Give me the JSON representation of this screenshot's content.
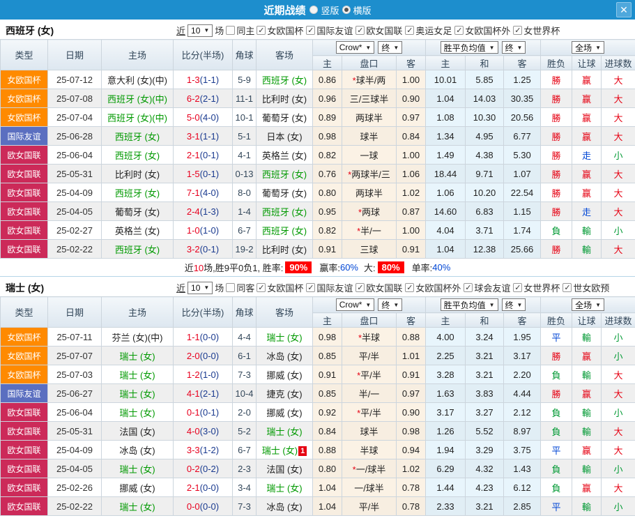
{
  "titlebar": {
    "title": "近期战绩",
    "radio_vertical": "竖版",
    "radio_horizontal": "横版",
    "close_glyph": "✕"
  },
  "icons": {
    "check": "✓",
    "arrow_down": "▼"
  },
  "colors": {
    "titlebar_blue": "#1d8ecd",
    "highlight_red": "#ff0000",
    "type_badge": {
      "女欧国杯": "#ff8a00",
      "国际友谊": "#5b6fc0",
      "欧女国联": "#cc2a59"
    },
    "result": {
      "r": "#e60012",
      "g": "#009933",
      "b": "#0046d5"
    }
  },
  "table_header": {
    "columns": [
      "类型",
      "日期",
      "主场",
      "比分(半场)",
      "角球",
      "客场"
    ],
    "sub": [
      "主",
      "盘口",
      "客",
      "主",
      "和",
      "客",
      "胜负",
      "让球",
      "进球数"
    ],
    "odds_source": "Crow*",
    "period1": "终",
    "avg_label": "胜平负均值",
    "period2": "终",
    "scope": "全场"
  },
  "sections": [
    {
      "team_title": "西班牙 (女)",
      "filter": {
        "near_label": "近",
        "count": "10",
        "games_label": "场",
        "same_label": "同主",
        "same_checked": false,
        "competitions": [
          "女欧国杯",
          "国际友谊",
          "欧女国联",
          "奥运女足",
          "女欧国杯外",
          "女世界杯"
        ]
      },
      "rows": [
        {
          "type": "女欧国杯",
          "date": "25-07-12",
          "home": "意大利 (女)(中)",
          "home_green": false,
          "ft": "1-3",
          "ht": "(1-1)",
          "corner": "5-9",
          "away": "西班牙 (女)",
          "away_green": true,
          "odds": [
            "0.86",
            "1.00"
          ],
          "handicap": "球半/两",
          "star": true,
          "avg": [
            "10.01",
            "5.85",
            "1.25"
          ],
          "results": [
            {
              "t": "勝",
              "c": "r"
            },
            {
              "t": "赢",
              "c": "r"
            },
            {
              "t": "大",
              "c": "r"
            }
          ]
        },
        {
          "type": "女欧国杯",
          "date": "25-07-08",
          "home": "西班牙 (女)(中)",
          "home_green": true,
          "ft": "6-2",
          "ht": "(2-1)",
          "corner": "11-1",
          "away": "比利时 (女)",
          "away_green": false,
          "odds": [
            "0.96",
            "0.90"
          ],
          "handicap": "三/三球半",
          "star": false,
          "avg": [
            "1.04",
            "14.03",
            "30.35"
          ],
          "results": [
            {
              "t": "勝",
              "c": "r"
            },
            {
              "t": "赢",
              "c": "r"
            },
            {
              "t": "大",
              "c": "r"
            }
          ]
        },
        {
          "type": "女欧国杯",
          "date": "25-07-04",
          "home": "西班牙 (女)(中)",
          "home_green": true,
          "ft": "5-0",
          "ht": "(4-0)",
          "corner": "10-1",
          "away": "葡萄牙 (女)",
          "away_green": false,
          "odds": [
            "0.89",
            "0.97"
          ],
          "handicap": "两球半",
          "star": false,
          "avg": [
            "1.08",
            "10.30",
            "20.56"
          ],
          "results": [
            {
              "t": "勝",
              "c": "r"
            },
            {
              "t": "赢",
              "c": "r"
            },
            {
              "t": "大",
              "c": "r"
            }
          ]
        },
        {
          "type": "国际友谊",
          "date": "25-06-28",
          "home": "西班牙 (女)",
          "home_green": true,
          "ft": "3-1",
          "ht": "(1-1)",
          "corner": "5-1",
          "away": "日本 (女)",
          "away_green": false,
          "odds": [
            "0.98",
            "0.84"
          ],
          "handicap": "球半",
          "star": false,
          "avg": [
            "1.34",
            "4.95",
            "6.77"
          ],
          "results": [
            {
              "t": "勝",
              "c": "r"
            },
            {
              "t": "赢",
              "c": "r"
            },
            {
              "t": "大",
              "c": "r"
            }
          ]
        },
        {
          "type": "欧女国联",
          "date": "25-06-04",
          "home": "西班牙 (女)",
          "home_green": true,
          "ft": "2-1",
          "ht": "(0-1)",
          "corner": "4-1",
          "away": "英格兰 (女)",
          "away_green": false,
          "odds": [
            "0.82",
            "1.00"
          ],
          "handicap": "一球",
          "star": false,
          "avg": [
            "1.49",
            "4.38",
            "5.30"
          ],
          "results": [
            {
              "t": "勝",
              "c": "r"
            },
            {
              "t": "走",
              "c": "b"
            },
            {
              "t": "小",
              "c": "g"
            }
          ]
        },
        {
          "type": "欧女国联",
          "date": "25-05-31",
          "home": "比利时 (女)",
          "home_green": false,
          "ft": "1-5",
          "ht": "(0-1)",
          "corner": "0-13",
          "away": "西班牙 (女)",
          "away_green": true,
          "odds": [
            "0.76",
            "1.06"
          ],
          "handicap": "两球半/三",
          "star": true,
          "avg": [
            "18.44",
            "9.71",
            "1.07"
          ],
          "results": [
            {
              "t": "勝",
              "c": "r"
            },
            {
              "t": "赢",
              "c": "r"
            },
            {
              "t": "大",
              "c": "r"
            }
          ]
        },
        {
          "type": "欧女国联",
          "date": "25-04-09",
          "home": "西班牙 (女)",
          "home_green": true,
          "ft": "7-1",
          "ht": "(4-0)",
          "corner": "8-0",
          "away": "葡萄牙 (女)",
          "away_green": false,
          "odds": [
            "0.80",
            "1.02"
          ],
          "handicap": "两球半",
          "star": false,
          "avg": [
            "1.06",
            "10.20",
            "22.54"
          ],
          "results": [
            {
              "t": "勝",
              "c": "r"
            },
            {
              "t": "赢",
              "c": "r"
            },
            {
              "t": "大",
              "c": "r"
            }
          ]
        },
        {
          "type": "欧女国联",
          "date": "25-04-05",
          "home": "葡萄牙 (女)",
          "home_green": false,
          "ft": "2-4",
          "ht": "(1-3)",
          "corner": "1-4",
          "away": "西班牙 (女)",
          "away_green": true,
          "odds": [
            "0.95",
            "0.87"
          ],
          "handicap": "两球",
          "star": true,
          "avg": [
            "14.60",
            "6.83",
            "1.15"
          ],
          "results": [
            {
              "t": "勝",
              "c": "r"
            },
            {
              "t": "走",
              "c": "b"
            },
            {
              "t": "大",
              "c": "r"
            }
          ]
        },
        {
          "type": "欧女国联",
          "date": "25-02-27",
          "home": "英格兰 (女)",
          "home_green": false,
          "ft": "1-0",
          "ht": "(1-0)",
          "corner": "6-7",
          "away": "西班牙 (女)",
          "away_green": true,
          "odds": [
            "0.82",
            "1.00"
          ],
          "handicap": "半/一",
          "star": true,
          "avg": [
            "4.04",
            "3.71",
            "1.74"
          ],
          "results": [
            {
              "t": "負",
              "c": "g"
            },
            {
              "t": "輸",
              "c": "g"
            },
            {
              "t": "小",
              "c": "g"
            }
          ]
        },
        {
          "type": "欧女国联",
          "date": "25-02-22",
          "home": "西班牙 (女)",
          "home_green": true,
          "ft": "3-2",
          "ht": "(0-1)",
          "corner": "19-2",
          "away": "比利时 (女)",
          "away_green": false,
          "odds": [
            "0.91",
            "0.91"
          ],
          "handicap": "三球",
          "star": false,
          "avg": [
            "1.04",
            "12.38",
            "25.66"
          ],
          "results": [
            {
              "t": "勝",
              "c": "r"
            },
            {
              "t": "輸",
              "c": "g"
            },
            {
              "t": "大",
              "c": "r"
            }
          ]
        }
      ],
      "summary": {
        "near": "近",
        "count": "10",
        "mid": "场,胜9平0负1, 胜率:",
        "win_rate": "90%",
        "label_win": "赢率:",
        "win_pct": "60%",
        "label_big": "大:",
        "big_rate": "80%",
        "label_single": "单率:",
        "single_pct": "40%"
      }
    },
    {
      "team_title": "瑞士 (女)",
      "filter": {
        "near_label": "近",
        "count": "10",
        "games_label": "场",
        "same_label": "同客",
        "same_checked": false,
        "competitions": [
          "女欧国杯",
          "国际友谊",
          "欧女国联",
          "女欧国杯外",
          "球会友谊",
          "女世界杯",
          "世女欧预"
        ]
      },
      "rows": [
        {
          "type": "女欧国杯",
          "date": "25-07-11",
          "home": "芬兰 (女)(中)",
          "home_green": false,
          "ft": "1-1",
          "ht": "(0-0)",
          "corner": "4-4",
          "away": "瑞士 (女)",
          "away_green": true,
          "odds": [
            "0.98",
            "0.88"
          ],
          "handicap": "半球",
          "star": true,
          "avg": [
            "4.00",
            "3.24",
            "1.95"
          ],
          "results": [
            {
              "t": "平",
              "c": "b"
            },
            {
              "t": "輸",
              "c": "g"
            },
            {
              "t": "小",
              "c": "g"
            }
          ]
        },
        {
          "type": "女欧国杯",
          "date": "25-07-07",
          "home": "瑞士 (女)",
          "home_green": true,
          "ft": "2-0",
          "ht": "(0-0)",
          "corner": "6-1",
          "away": "冰岛 (女)",
          "away_green": false,
          "odds": [
            "0.85",
            "1.01"
          ],
          "handicap": "平/半",
          "star": false,
          "avg": [
            "2.25",
            "3.21",
            "3.17"
          ],
          "results": [
            {
              "t": "勝",
              "c": "r"
            },
            {
              "t": "赢",
              "c": "r"
            },
            {
              "t": "小",
              "c": "g"
            }
          ]
        },
        {
          "type": "女欧国杯",
          "date": "25-07-03",
          "home": "瑞士 (女)",
          "home_green": true,
          "ft": "1-2",
          "ht": "(1-0)",
          "corner": "7-3",
          "away": "挪威 (女)",
          "away_green": false,
          "odds": [
            "0.91",
            "0.91"
          ],
          "handicap": "平/半",
          "star": true,
          "avg": [
            "3.28",
            "3.21",
            "2.20"
          ],
          "results": [
            {
              "t": "負",
              "c": "g"
            },
            {
              "t": "輸",
              "c": "g"
            },
            {
              "t": "大",
              "c": "r"
            }
          ]
        },
        {
          "type": "国际友谊",
          "date": "25-06-27",
          "home": "瑞士 (女)",
          "home_green": true,
          "ft": "4-1",
          "ht": "(2-1)",
          "corner": "10-4",
          "away": "捷克 (女)",
          "away_green": false,
          "odds": [
            "0.85",
            "0.97"
          ],
          "handicap": "半/一",
          "star": false,
          "avg": [
            "1.63",
            "3.83",
            "4.44"
          ],
          "results": [
            {
              "t": "勝",
              "c": "r"
            },
            {
              "t": "赢",
              "c": "r"
            },
            {
              "t": "大",
              "c": "r"
            }
          ]
        },
        {
          "type": "欧女国联",
          "date": "25-06-04",
          "home": "瑞士 (女)",
          "home_green": true,
          "ft": "0-1",
          "ht": "(0-1)",
          "corner": "2-0",
          "away": "挪威 (女)",
          "away_green": false,
          "odds": [
            "0.92",
            "0.90"
          ],
          "handicap": "平/半",
          "star": true,
          "avg": [
            "3.17",
            "3.27",
            "2.12"
          ],
          "results": [
            {
              "t": "負",
              "c": "g"
            },
            {
              "t": "輸",
              "c": "g"
            },
            {
              "t": "小",
              "c": "g"
            }
          ]
        },
        {
          "type": "欧女国联",
          "date": "25-05-31",
          "home": "法国 (女)",
          "home_green": false,
          "ft": "4-0",
          "ht": "(3-0)",
          "corner": "5-2",
          "away": "瑞士 (女)",
          "away_green": true,
          "odds": [
            "0.84",
            "0.98"
          ],
          "handicap": "球半",
          "star": false,
          "avg": [
            "1.26",
            "5.52",
            "8.97"
          ],
          "results": [
            {
              "t": "負",
              "c": "g"
            },
            {
              "t": "輸",
              "c": "g"
            },
            {
              "t": "大",
              "c": "r"
            }
          ]
        },
        {
          "type": "欧女国联",
          "date": "25-04-09",
          "home": "冰岛 (女)",
          "home_green": false,
          "ft": "3-3",
          "ht": "(1-2)",
          "corner": "6-7",
          "away": "瑞士 (女)",
          "away_green": true,
          "away_badge": "1",
          "odds": [
            "0.88",
            "0.94"
          ],
          "handicap": "半球",
          "star": false,
          "avg": [
            "1.94",
            "3.29",
            "3.75"
          ],
          "results": [
            {
              "t": "平",
              "c": "b"
            },
            {
              "t": "赢",
              "c": "r"
            },
            {
              "t": "大",
              "c": "r"
            }
          ]
        },
        {
          "type": "欧女国联",
          "date": "25-04-05",
          "home": "瑞士 (女)",
          "home_green": true,
          "ft": "0-2",
          "ht": "(0-2)",
          "corner": "2-3",
          "away": "法国 (女)",
          "away_green": false,
          "odds": [
            "0.80",
            "1.02"
          ],
          "handicap": "一/球半",
          "star": true,
          "avg": [
            "6.29",
            "4.32",
            "1.43"
          ],
          "results": [
            {
              "t": "負",
              "c": "g"
            },
            {
              "t": "輸",
              "c": "g"
            },
            {
              "t": "小",
              "c": "g"
            }
          ]
        },
        {
          "type": "欧女国联",
          "date": "25-02-26",
          "home": "挪威 (女)",
          "home_green": false,
          "ft": "2-1",
          "ht": "(0-0)",
          "corner": "3-4",
          "away": "瑞士 (女)",
          "away_green": true,
          "odds": [
            "1.04",
            "0.78"
          ],
          "handicap": "一/球半",
          "star": false,
          "avg": [
            "1.44",
            "4.23",
            "6.12"
          ],
          "results": [
            {
              "t": "負",
              "c": "g"
            },
            {
              "t": "赢",
              "c": "r"
            },
            {
              "t": "大",
              "c": "r"
            }
          ]
        },
        {
          "type": "欧女国联",
          "date": "25-02-22",
          "home": "瑞士 (女)",
          "home_green": true,
          "ft": "0-0",
          "ht": "(0-0)",
          "corner": "7-3",
          "away": "冰岛 (女)",
          "away_green": false,
          "odds": [
            "1.04",
            "0.78"
          ],
          "handicap": "平/半",
          "star": false,
          "avg": [
            "2.33",
            "3.21",
            "2.85"
          ],
          "results": [
            {
              "t": "平",
              "c": "b"
            },
            {
              "t": "輸",
              "c": "g"
            },
            {
              "t": "小",
              "c": "g"
            }
          ]
        }
      ]
    }
  ]
}
